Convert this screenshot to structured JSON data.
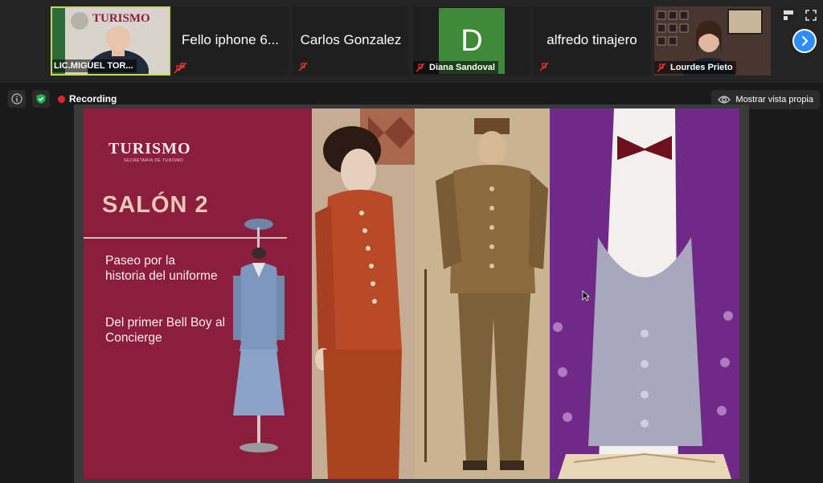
{
  "participants": [
    {
      "name": "LIC.MIGUEL TOR...",
      "muted": true,
      "video": true
    },
    {
      "name": "Fello iphone 6...",
      "muted": true,
      "video": false
    },
    {
      "name": "Carlos Gonzalez",
      "muted": true,
      "video": false
    },
    {
      "name": "Diana Sandoval",
      "muted": true,
      "video": false,
      "initial": "D"
    },
    {
      "name": "alfredo tinajero",
      "muted": true,
      "video": false
    },
    {
      "name": "Lourdes Prieto",
      "muted": true,
      "video": true
    }
  ],
  "tile_logo_text": "TURISMO",
  "status": {
    "recording_label": "Recording",
    "self_view_label": "Mostrar vista propia"
  },
  "slide": {
    "logo": "TURISMO",
    "logo_sub": "SECRETARÍA DE TURISMO",
    "title": "SALÓN 2",
    "desc_line1": "Paseo por la historia del uniforme",
    "desc_line2": "Del primer Bell Boy al Concierge"
  },
  "colors": {
    "slide_accent": "#8c1e3d",
    "active_speaker_border": "#c9d75a",
    "next_button": "#2d8cff",
    "recording_dot": "#e02828"
  },
  "icons": [
    "info-icon",
    "shield-check-icon",
    "eye-icon",
    "next-arrow-icon",
    "view-icon",
    "fullscreen-icon",
    "mic-muted-icon"
  ]
}
